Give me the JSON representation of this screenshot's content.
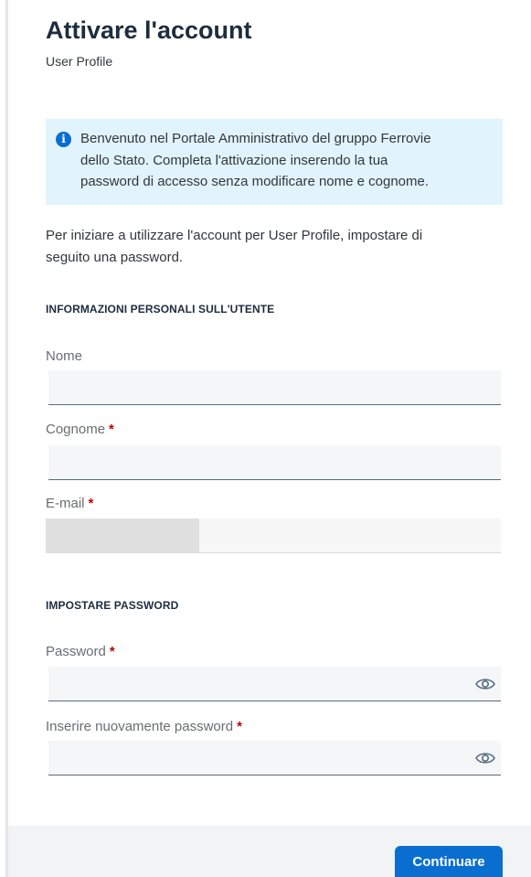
{
  "header": {
    "title": "Attivare l'account",
    "subtitle": "User Profile"
  },
  "info": {
    "icon": "info-icon",
    "line1": "Benvenuto nel Portale Amministrativo del gruppo Ferrovie",
    "line2": "dello Stato. Completa l'attivazione inserendo la tua",
    "line3": "password di accesso senza modificare nome e cognome."
  },
  "intro": {
    "line1": "Per iniziare a utilizzare l'account per User Profile, impostare di",
    "line2": "seguito una password."
  },
  "personal_section": {
    "heading": "INFORMAZIONI PERSONALI SULL'UTENTE",
    "first_name_label": "Nome",
    "first_name_value": "",
    "last_name_label": "Cognome",
    "last_name_value": "",
    "email_label": "E-mail",
    "email_value": ""
  },
  "password_section": {
    "heading": "IMPOSTARE PASSWORD",
    "password_label": "Password",
    "password_value": "",
    "confirm_label": "Inserire nuovamente password",
    "confirm_value": ""
  },
  "required_marker": "*",
  "footer": {
    "continue_label": "Continuare"
  },
  "colors": {
    "accent": "#0a6ed1",
    "info_bg": "#e1f4fd",
    "required": "#bb0000"
  }
}
